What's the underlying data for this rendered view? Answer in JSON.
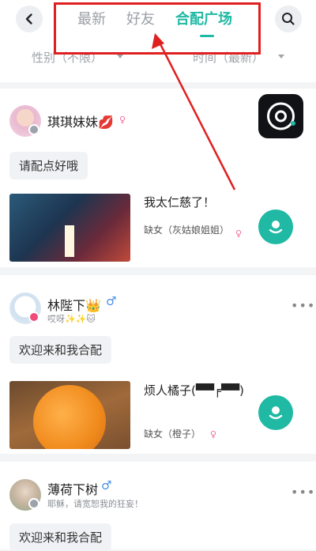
{
  "header": {
    "back_icon": "chevron-left-icon",
    "search_icon": "magnifier-icon",
    "tabs": [
      {
        "label": "最新",
        "active": false
      },
      {
        "label": "好友",
        "active": false
      },
      {
        "label": "合配广场",
        "active": true
      }
    ],
    "filters": [
      {
        "label": "性别（不限）"
      },
      {
        "label": "时间（最新）"
      }
    ]
  },
  "posts": [
    {
      "user": "琪琪妹妹💋",
      "gender": "female",
      "greeting": "请配点好哦",
      "clip": {
        "title": "我太仁慈了！",
        "role": "缺女（灰姑娘姐姐）"
      }
    },
    {
      "user": "林陛下👑",
      "gender": "male",
      "subtitle": "哎呀✨✨🐱",
      "greeting": "欢迎来和我合配",
      "clip": {
        "title": "烦人橘子(▀▀╒▀▀)",
        "role": "缺女（橙子）"
      }
    },
    {
      "user": "薄荷下树",
      "gender": "male",
      "subtitle": "耶稣，请宽恕我的狂妄！",
      "greeting": "欢迎来和我合配"
    }
  ],
  "symbols": {
    "male": "♂",
    "female": "♀",
    "more": "•••"
  },
  "colors": {
    "accent": "#1fb9a4",
    "annotation": "#e02020"
  }
}
